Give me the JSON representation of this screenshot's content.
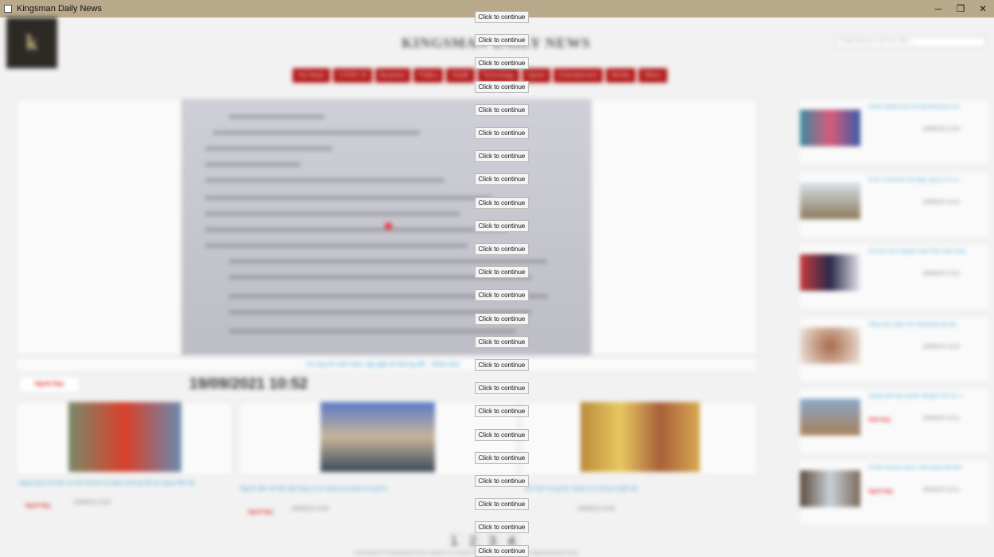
{
  "window": {
    "title": "Kingsman Daily News",
    "controls": [
      "─",
      "❐",
      "✕"
    ]
  },
  "site": {
    "masthead": "KINGSMAN DAILY NEWS",
    "logo_letter": "k",
    "search_placeholder": "Nhập thông tin cần tìm kiếm..."
  },
  "nav": [
    "Hot News",
    "COVID-19",
    "Business",
    "Politics",
    "Health",
    "Technology",
    "Sports",
    "Entertainment",
    "Worlds",
    "Others"
  ],
  "featured": {
    "caption": "Cụ ông đi xuất chạn cấp giấy đi đường để... khám thai",
    "badge": "Người Đẹp",
    "datetime": "19/09/2021 10:52"
  },
  "articles": [
    {
      "title": "Người phụ nữ bán xe mỡ COVID-19 quên trường hãn ko nguời đến đó",
      "badge": "Người Đẹp",
      "date": "19/09/2021 10:50"
    },
    {
      "title": "Người dân Hà Nội xếp hàng ra về sáng mua bánh trung thu",
      "badge": "Người Đẹp",
      "date": "19/09/2021 10:48"
    },
    {
      "title": "Đồ chơi Trung thu 'made in' ở Enrue tuyên bố",
      "badge": "",
      "date": "19/09/2021 10:45"
    }
  ],
  "sidebar": [
    {
      "title": "Doanh nghiệp được đề nghị không áp mức...",
      "badge": "",
      "date": "19/09/2021 10:44"
    },
    {
      "title": "Đi bộ 7.000 bước mỗi ngày, nguy cơ tử vo...",
      "badge": "",
      "date": "19/09/2021 10:42"
    },
    {
      "title": "Chủ tịch nước Nguyễn Xuân Phúc thăm Cuba",
      "badge": "",
      "date": "19/09/2021 10:42"
    },
    {
      "title": "Hằng nhan ngắm Kim Kardashian lần đầu",
      "badge": "",
      "date": "19/09/2021 10:40"
    },
    {
      "title": "Quảng Nam tiếp chuyển..để giảm chỗ các c...",
      "badge": "Nhân Đẹp",
      "date": "19/09/2021 10:21"
    },
    {
      "title": "Về đích dung lô người; nắng nặng, bão bình",
      "badge": "Người Đẹp",
      "date": "19/09/2021 10:21"
    }
  ],
  "pager": [
    "1",
    "2",
    "3",
    "4"
  ],
  "footer": "COPYRIGHT © KINGSMAN DAILY NEWS. ALL RIGHTS RESERVED. CONTACT US@KINGSMAN.COM",
  "overlay": {
    "label": "Click to continue",
    "count": 24
  }
}
